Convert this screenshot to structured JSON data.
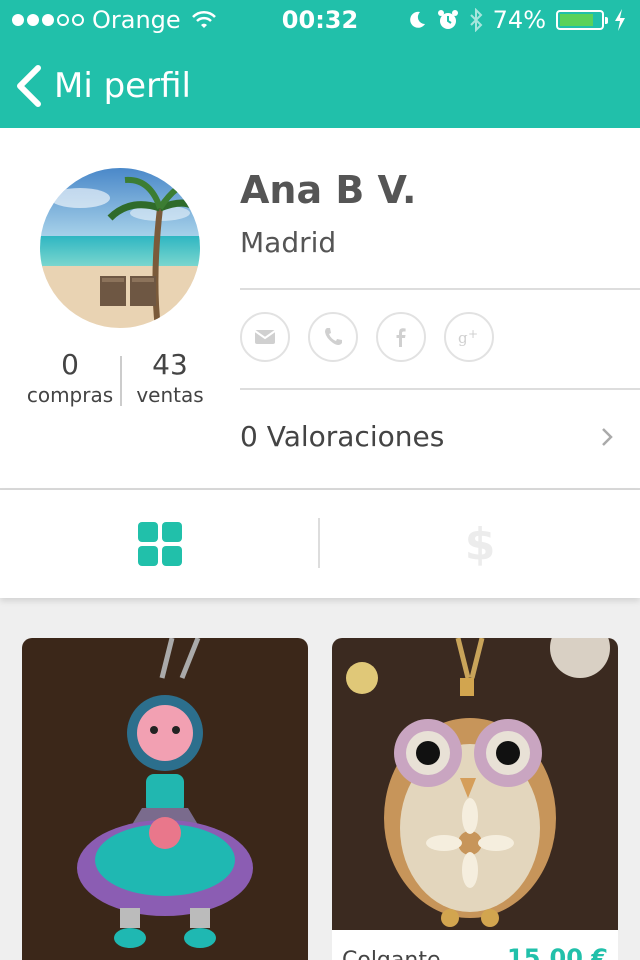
{
  "status_bar": {
    "carrier": "Orange",
    "time": "00:32",
    "battery": "74%",
    "battery_level": 0.74
  },
  "nav": {
    "back_label": "Mi perfil"
  },
  "profile": {
    "name": "Ana B V.",
    "city": "Madrid",
    "compras_count": "0",
    "compras_label": "compras",
    "ventas_count": "43",
    "ventas_label": "ventas",
    "valoraciones": "0 Valoraciones",
    "social_icons": [
      "mail-icon",
      "phone-icon",
      "facebook-icon",
      "google-plus-icon"
    ]
  },
  "tabs": {
    "items": [
      "grid-icon",
      "dollar-icon"
    ],
    "active": "grid-icon"
  },
  "products": [
    {
      "title": "",
      "price": ""
    },
    {
      "title": "Colgante",
      "price": "15,00 €"
    }
  ],
  "colors": {
    "accent": "#21c0aa",
    "background": "#efefef"
  }
}
